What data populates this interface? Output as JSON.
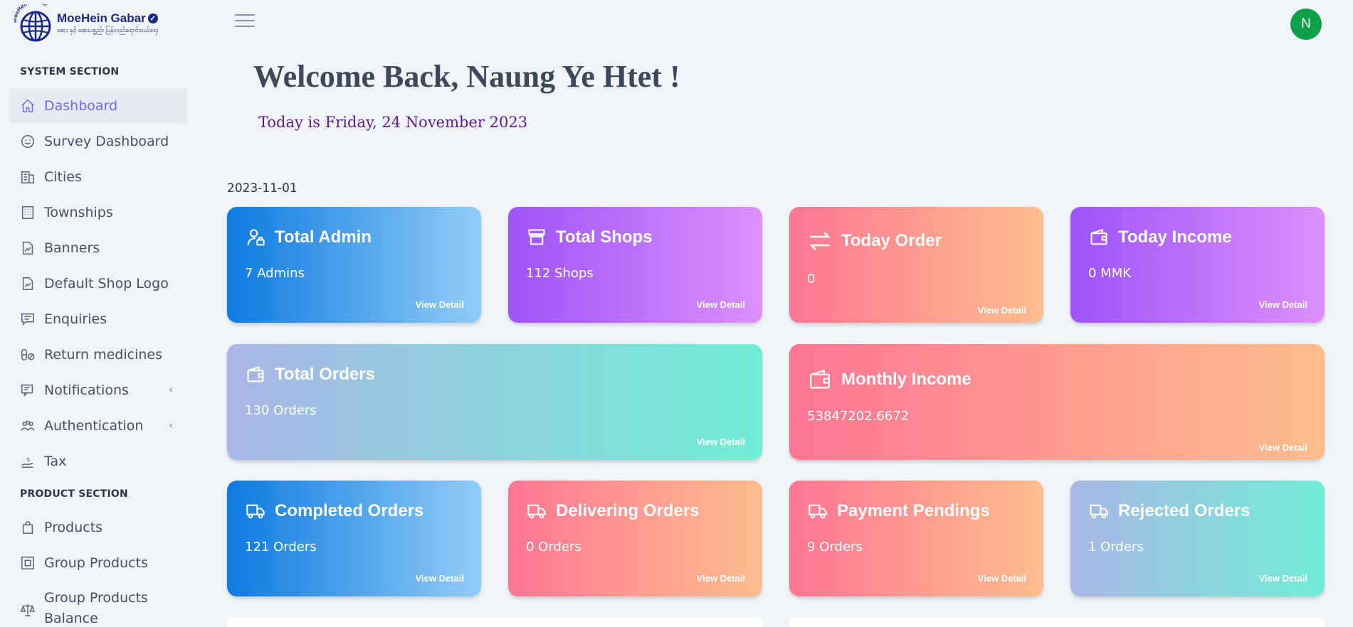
{
  "brand": {
    "title": "MoeHein Gabar",
    "subtitle": "ဆေး နှင့် ဆေးပစ္စည်း ပြန်လည်ရောင်းဝယ်ရေး",
    "arc_text": "MoeHein Gabar"
  },
  "sidebar": {
    "system_section": "SYSTEM SECTION",
    "product_section": "PRODUCT SECTION",
    "items": [
      {
        "label": "Dashboard",
        "icon": "home-icon",
        "active": true
      },
      {
        "label": "Survey Dashboard",
        "icon": "smile-icon"
      },
      {
        "label": "Cities",
        "icon": "building-icon"
      },
      {
        "label": "Townships",
        "icon": "office-building-icon"
      },
      {
        "label": "Banners",
        "icon": "image-file-icon"
      },
      {
        "label": "Default Shop Logo",
        "icon": "image-file-icon"
      },
      {
        "label": "Enquiries",
        "icon": "message-icon"
      },
      {
        "label": "Return medicines",
        "icon": "pills-icon"
      },
      {
        "label": "Notifications",
        "icon": "chat-screen-icon",
        "expandable": true
      },
      {
        "label": "Authentication",
        "icon": "users-group-icon",
        "expandable": true
      },
      {
        "label": "Tax",
        "icon": "hand-coin-icon"
      }
    ],
    "product_items": [
      {
        "label": "Products",
        "icon": "shopping-bag-icon"
      },
      {
        "label": "Group Products",
        "icon": "group-box-icon"
      },
      {
        "label": "Group Products Balance",
        "icon": "scale-icon"
      }
    ]
  },
  "header": {
    "avatar_letter": "N"
  },
  "main": {
    "welcome": "Welcome Back, Naung Ye Htet !",
    "today": "Today is Friday, 24 November 2023",
    "date": "2023-11-01",
    "view_detail": "View Detail",
    "cards": [
      {
        "title": "Total Admin",
        "value": "7 Admins",
        "icon": "admin-user-icon",
        "gradient": "blue"
      },
      {
        "title": "Total Shops",
        "value": "112 Shops",
        "icon": "store-icon",
        "gradient": "purple"
      },
      {
        "title": "Today Order",
        "value": "0",
        "icon": "transfer-arrows-icon",
        "gradient": "pink"
      },
      {
        "title": "Today Income",
        "value": "0 MMK",
        "icon": "wallet-icon",
        "gradient": "purple"
      },
      {
        "title": "Total Orders",
        "value": "130 Orders",
        "icon": "wallet-icon",
        "gradient": "teal"
      },
      {
        "title": "Monthly Income",
        "value": "53847202.6672",
        "icon": "wallet-icon",
        "gradient": "pink"
      },
      {
        "title": "Completed Orders",
        "value": "121 Orders",
        "icon": "truck-icon",
        "gradient": "blue"
      },
      {
        "title": "Delivering Orders",
        "value": "0 Orders",
        "icon": "truck-icon",
        "gradient": "pink"
      },
      {
        "title": "Payment Pendings",
        "value": "9 Orders",
        "icon": "truck-icon",
        "gradient": "pink"
      },
      {
        "title": "Rejected Orders",
        "value": "1 Orders",
        "icon": "truck-icon",
        "gradient": "teal"
      }
    ]
  },
  "colors": {
    "accent": "#7467ee",
    "avatar_bg": "#0e9f4a",
    "brand": "#1c2a86"
  }
}
